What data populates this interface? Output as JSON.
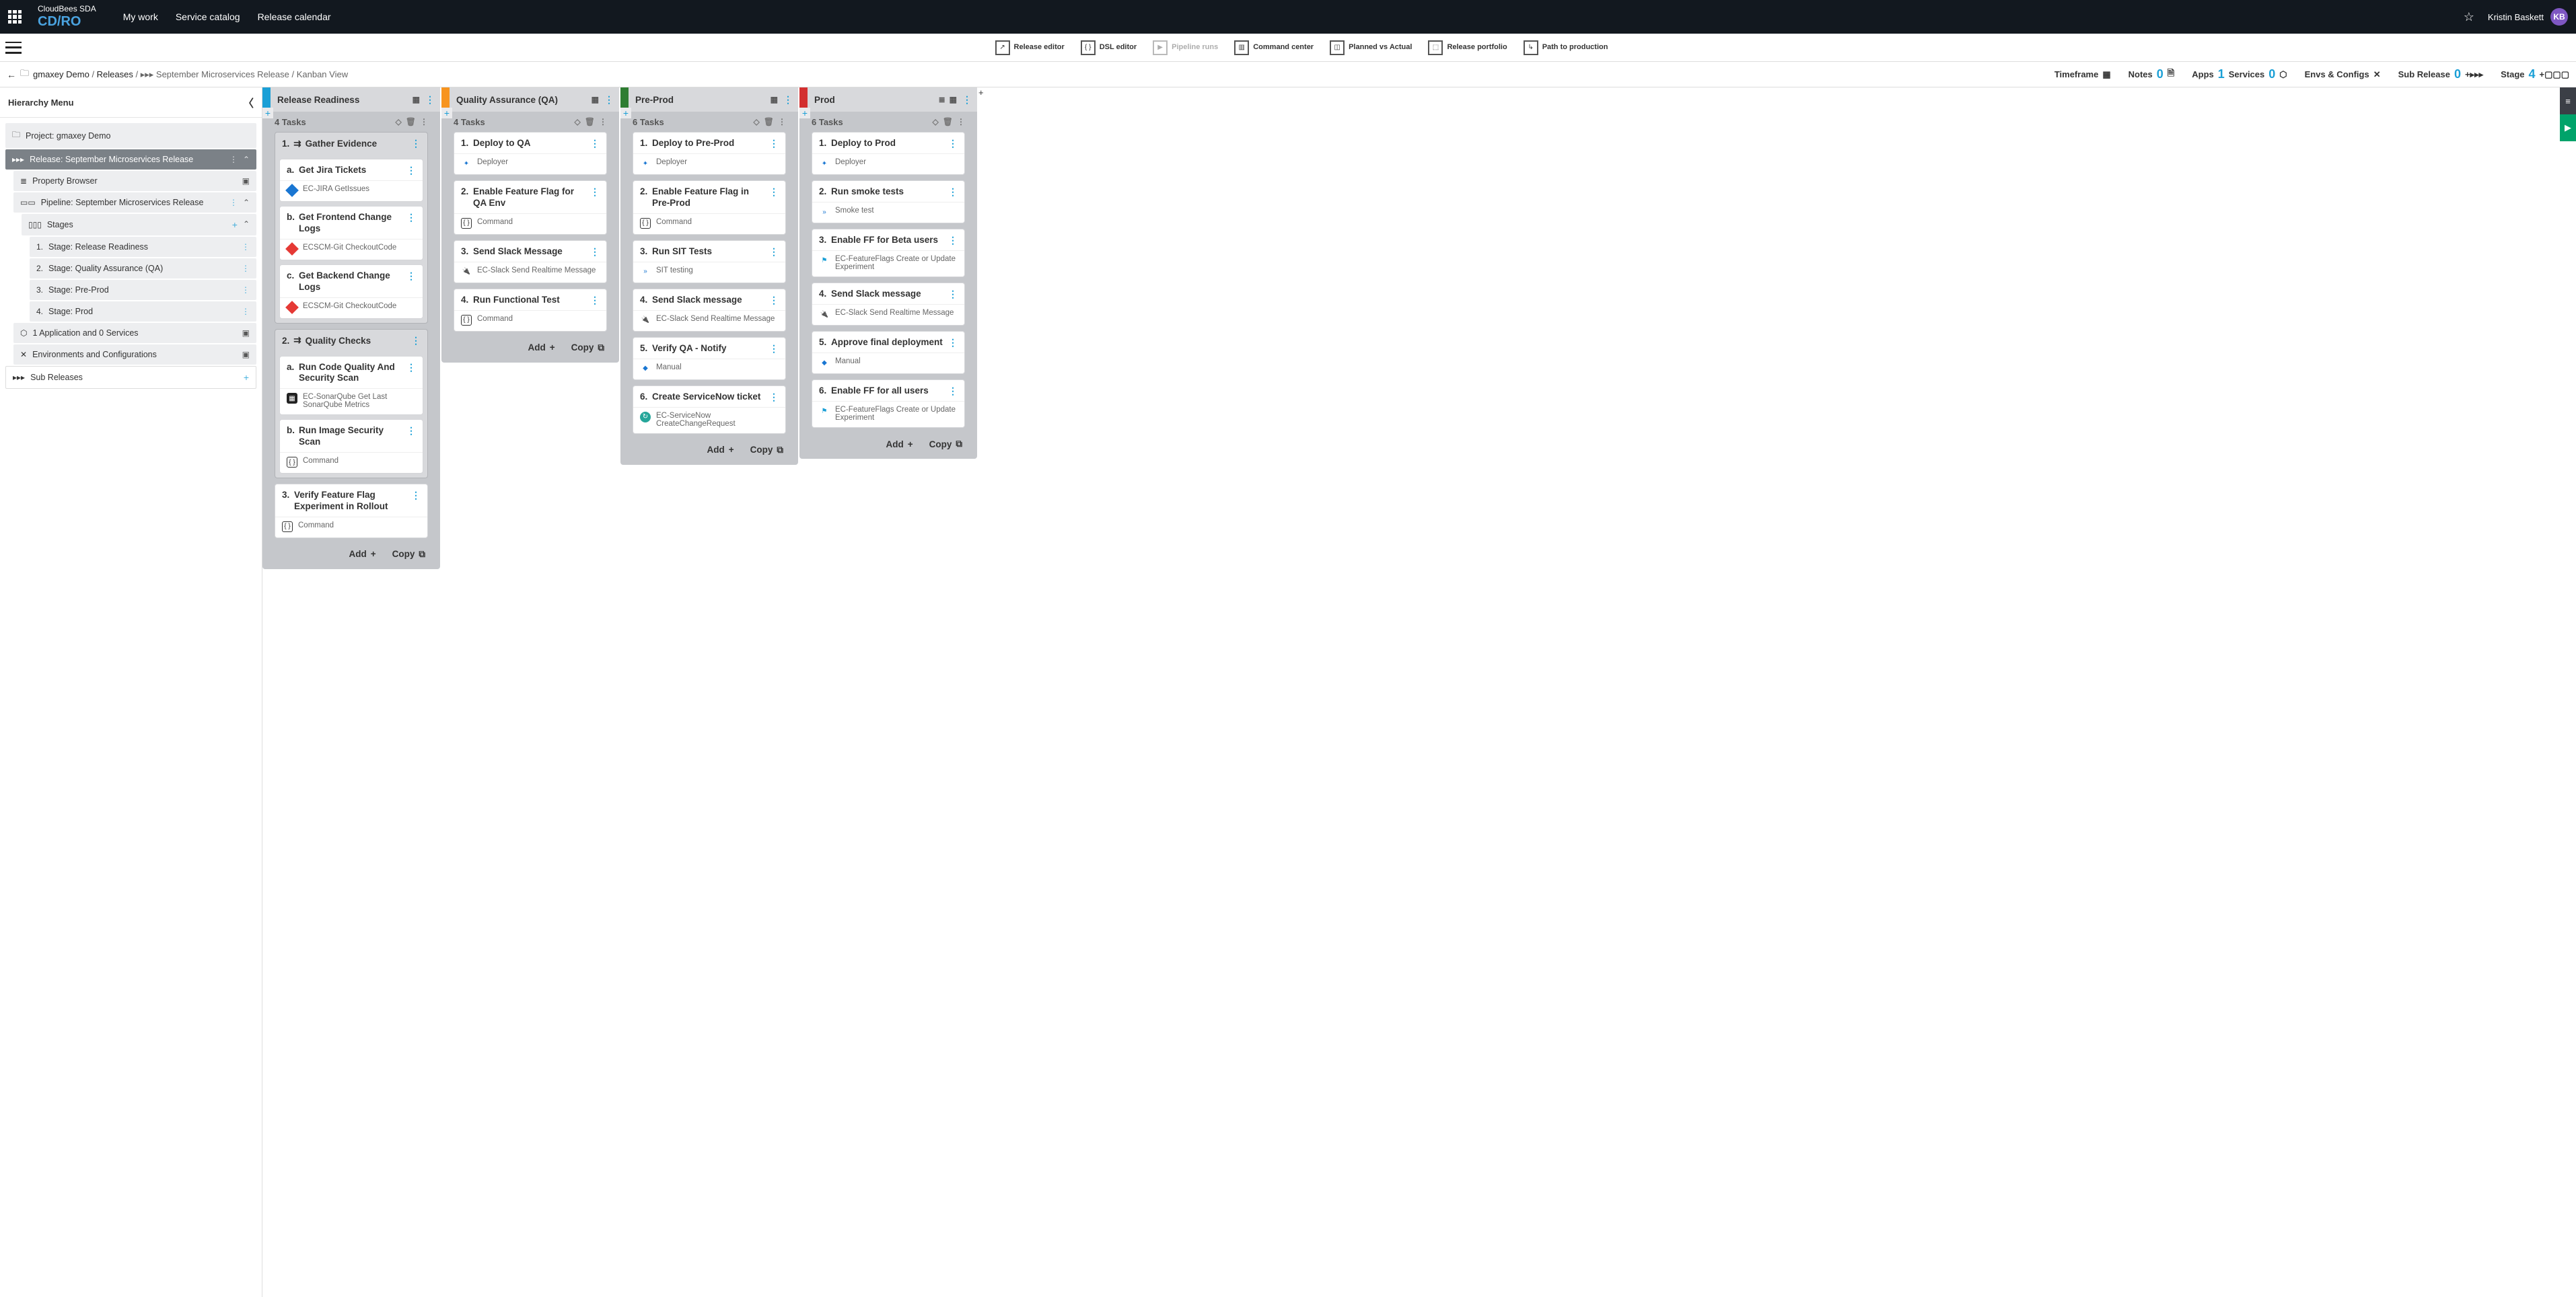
{
  "header": {
    "brand_top": "CloudBees SDA",
    "brand_bottom": "CD/RO",
    "nav": [
      "My work",
      "Service catalog",
      "Release calendar"
    ],
    "user_name": "Kristin Baskett",
    "user_initials": "KB"
  },
  "toolbar": {
    "release_editor": "Release editor",
    "dsl_editor": "DSL editor",
    "pipeline_runs": "Pipeline runs",
    "command_center": "Command center",
    "planned_actual": "Planned vs Actual",
    "release_portfolio": "Release portfolio",
    "path_prod": "Path to production"
  },
  "breadcrumb": {
    "project": "gmaxey Demo",
    "releases": "Releases",
    "release": "September Microservices Release",
    "view": "Kanban View"
  },
  "sub_metrics": {
    "timeframe": "Timeframe",
    "notes": "Notes",
    "notes_count": "0",
    "apps": "Apps",
    "apps_count": "1",
    "services": "Services",
    "services_count": "0",
    "envs": "Envs & Configs",
    "subrel": "Sub Release",
    "subrel_count": "0",
    "stage": "Stage",
    "stage_count": "4"
  },
  "hierarchy": {
    "title": "Hierarchy Menu",
    "project": "Project: gmaxey Demo",
    "release": "Release: September Microservices Release",
    "property_browser": "Property Browser",
    "pipeline": "Pipeline: September Microservices Release",
    "stages_label": "Stages",
    "stages": [
      "Stage: Release Readiness",
      "Stage: Quality Assurance (QA)",
      "Stage: Pre-Prod",
      "Stage: Prod"
    ],
    "apps_services": "1 Application and 0 Services",
    "env_config": "Environments and Configurations",
    "sub_releases": "Sub Releases"
  },
  "stages": [
    {
      "name": "Release Readiness",
      "tasks_label": "4 Tasks",
      "color": "#1a9fd6",
      "groups": [
        {
          "num": "1.",
          "title": "Gather Evidence",
          "tasks": [
            {
              "lbl": "a.",
              "title": "Get Jira Tickets",
              "sub": "EC-JIRA GetIssues",
              "icon": "blue-diamond"
            },
            {
              "lbl": "b.",
              "title": "Get Frontend Change Logs",
              "sub": "ECSCM-Git CheckoutCode",
              "icon": "red-diamond"
            },
            {
              "lbl": "c.",
              "title": "Get Backend Change Logs",
              "sub": "ECSCM-Git CheckoutCode",
              "icon": "red-diamond"
            }
          ]
        },
        {
          "num": "2.",
          "title": "Quality Checks",
          "tasks": [
            {
              "lbl": "a.",
              "title": "Run Code Quality And Security Scan",
              "sub": "EC-SonarQube Get Last SonarQube Metrics",
              "icon": "black-sq"
            },
            {
              "lbl": "b.",
              "title": "Run Image Security Scan",
              "sub": "Command",
              "icon": "cmd"
            }
          ]
        }
      ],
      "solo": [
        {
          "lbl": "3.",
          "title": "Verify Feature Flag Experiment in Rollout",
          "sub": "Command",
          "icon": "cmd"
        }
      ],
      "add": "Add",
      "copy": "Copy"
    },
    {
      "name": "Quality Assurance (QA)",
      "tasks_label": "4 Tasks",
      "color": "#f7941e",
      "groups": [],
      "solo": [
        {
          "lbl": "1.",
          "title": "Deploy to QA",
          "sub": "Deployer",
          "icon": "deployer"
        },
        {
          "lbl": "2.",
          "title": "Enable Feature Flag for QA Env",
          "sub": "Command",
          "icon": "cmd"
        },
        {
          "lbl": "3.",
          "title": "Send Slack Message",
          "sub": "EC-Slack Send Realtime Message",
          "icon": "plug"
        },
        {
          "lbl": "4.",
          "title": "Run Functional Test",
          "sub": "Command",
          "icon": "cmd"
        }
      ],
      "add": "Add",
      "copy": "Copy"
    },
    {
      "name": "Pre-Prod",
      "tasks_label": "6 Tasks",
      "color": "#2e7d32",
      "groups": [],
      "solo": [
        {
          "lbl": "1.",
          "title": "Deploy to Pre-Prod",
          "sub": "Deployer",
          "icon": "deployer"
        },
        {
          "lbl": "2.",
          "title": "Enable Feature Flag in Pre-Prod",
          "sub": "Command",
          "icon": "cmd"
        },
        {
          "lbl": "3.",
          "title": "Run SIT Tests",
          "sub": "SIT testing",
          "icon": "blue-chevrons"
        },
        {
          "lbl": "4.",
          "title": "Send Slack message",
          "sub": "EC-Slack Send Realtime Message",
          "icon": "plug"
        },
        {
          "lbl": "5.",
          "title": "Verify QA - Notify",
          "sub": "Manual",
          "icon": "manual"
        },
        {
          "lbl": "6.",
          "title": "Create ServiceNow ticket",
          "sub": "EC-ServiceNow CreateChangeRequest",
          "icon": "teal-circle"
        }
      ],
      "add": "Add",
      "copy": "Copy"
    },
    {
      "name": "Prod",
      "tasks_label": "6 Tasks",
      "color": "#d32f2f",
      "groups": [],
      "solo": [
        {
          "lbl": "1.",
          "title": "Deploy to Prod",
          "sub": "Deployer",
          "icon": "deployer"
        },
        {
          "lbl": "2.",
          "title": "Run smoke tests",
          "sub": "Smoke test",
          "icon": "blue-chevrons"
        },
        {
          "lbl": "3.",
          "title": "Enable FF for Beta users",
          "sub": "EC-FeatureFlags Create or Update Experiment",
          "icon": "cyan-flags"
        },
        {
          "lbl": "4.",
          "title": "Send Slack message",
          "sub": "EC-Slack Send Realtime Message",
          "icon": "plug"
        },
        {
          "lbl": "5.",
          "title": "Approve final deployment",
          "sub": "Manual",
          "icon": "manual"
        },
        {
          "lbl": "6.",
          "title": "Enable FF for all users",
          "sub": "EC-FeatureFlags Create or Update Experiment",
          "icon": "cyan-flags"
        }
      ],
      "add": "Add",
      "copy": "Copy"
    }
  ]
}
